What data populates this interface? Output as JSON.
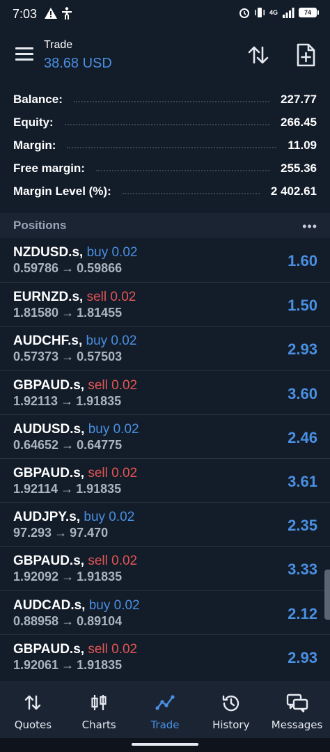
{
  "status_bar": {
    "time": "7:03",
    "network": "4G",
    "battery": "74"
  },
  "header": {
    "title": "Trade",
    "subtitle": "38.68 USD"
  },
  "summary": [
    {
      "label": "Balance:",
      "value": "227.77"
    },
    {
      "label": "Equity:",
      "value": "266.45"
    },
    {
      "label": "Margin:",
      "value": "11.09"
    },
    {
      "label": "Free margin:",
      "value": "255.36"
    },
    {
      "label": "Margin Level (%):",
      "value": "2 402.61"
    }
  ],
  "positions": {
    "title": "Positions",
    "more": "•••",
    "items": [
      {
        "symbol": "NZDUSD.s,",
        "side": "buy 0.02",
        "type": "buy",
        "open": "0.59786",
        "arrow": "→",
        "current": "0.59866",
        "profit": "1.60"
      },
      {
        "symbol": "EURNZD.s,",
        "side": "sell 0.02",
        "type": "sell",
        "open": "1.81580",
        "arrow": "→",
        "current": "1.81455",
        "profit": "1.50"
      },
      {
        "symbol": "AUDCHF.s,",
        "side": "buy 0.02",
        "type": "buy",
        "open": "0.57373",
        "arrow": "→",
        "current": "0.57503",
        "profit": "2.93"
      },
      {
        "symbol": "GBPAUD.s,",
        "side": "sell 0.02",
        "type": "sell",
        "open": "1.92113",
        "arrow": "→",
        "current": "1.91835",
        "profit": "3.60"
      },
      {
        "symbol": "AUDUSD.s,",
        "side": "buy 0.02",
        "type": "buy",
        "open": "0.64652",
        "arrow": "→",
        "current": "0.64775",
        "profit": "2.46"
      },
      {
        "symbol": "GBPAUD.s,",
        "side": "sell 0.02",
        "type": "sell",
        "open": "1.92114",
        "arrow": "→",
        "current": "1.91835",
        "profit": "3.61"
      },
      {
        "symbol": "AUDJPY.s,",
        "side": "buy 0.02",
        "type": "buy",
        "open": "97.293",
        "arrow": "→",
        "current": "97.470",
        "profit": "2.35"
      },
      {
        "symbol": "GBPAUD.s,",
        "side": "sell 0.02",
        "type": "sell",
        "open": "1.92092",
        "arrow": "→",
        "current": "1.91835",
        "profit": "3.33"
      },
      {
        "symbol": "AUDCAD.s,",
        "side": "buy 0.02",
        "type": "buy",
        "open": "0.88958",
        "arrow": "→",
        "current": "0.89104",
        "profit": "2.12"
      },
      {
        "symbol": "GBPAUD.s,",
        "side": "sell 0.02",
        "type": "sell",
        "open": "1.92061",
        "arrow": "→",
        "current": "1.91835",
        "profit": "2.93"
      }
    ]
  },
  "nav": [
    {
      "label": "Quotes",
      "icon": "quotes-icon",
      "active": false
    },
    {
      "label": "Charts",
      "icon": "charts-icon",
      "active": false
    },
    {
      "label": "Trade",
      "icon": "trade-icon",
      "active": true
    },
    {
      "label": "History",
      "icon": "history-icon",
      "active": false
    },
    {
      "label": "Messages",
      "icon": "messages-icon",
      "active": false
    }
  ],
  "colors": {
    "background": "#131c29",
    "accent": "#4a90e2",
    "sell": "#e25555",
    "muted": "#aab3c0"
  }
}
